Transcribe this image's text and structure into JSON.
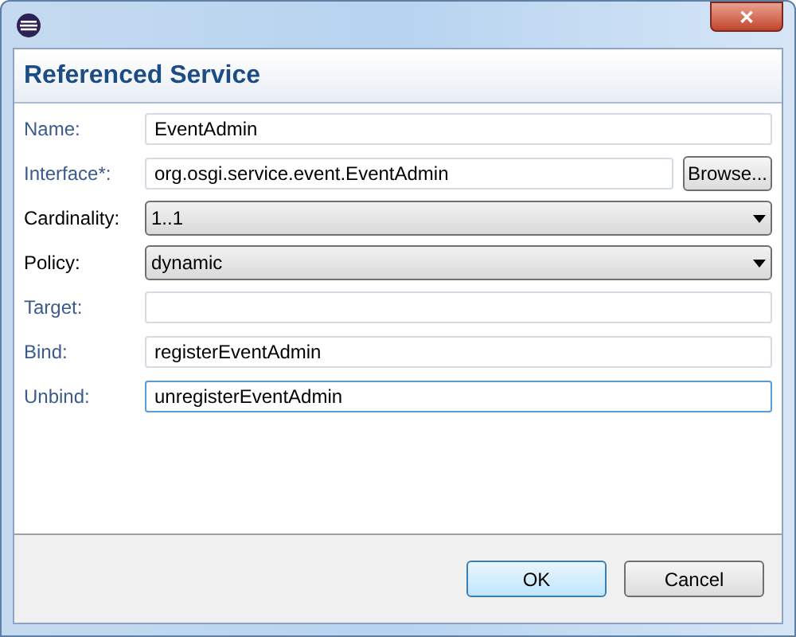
{
  "window": {
    "close_glyph": "✕"
  },
  "header": {
    "title": "Referenced Service"
  },
  "fields": [
    {
      "kind": "text",
      "label": "Name:",
      "link": true,
      "value": "EventAdmin",
      "focused": false
    },
    {
      "kind": "text",
      "label": "Interface*:",
      "link": true,
      "value": "org.osgi.service.event.EventAdmin",
      "focused": false,
      "button": "Browse..."
    },
    {
      "kind": "combo",
      "label": "Cardinality:",
      "link": false,
      "value": "1..1"
    },
    {
      "kind": "combo",
      "label": "Policy:",
      "link": false,
      "value": "dynamic"
    },
    {
      "kind": "text",
      "label": "Target:",
      "link": true,
      "focused": false
    },
    {
      "kind": "text",
      "label": "Bind:",
      "link": true,
      "value": "registerEventAdmin",
      "focused": false
    },
    {
      "kind": "text",
      "label": "Unbind:",
      "link": true,
      "value": "unregisterEventAdmin",
      "focused": true
    }
  ],
  "buttons": [
    {
      "label": "OK",
      "default": true
    },
    {
      "label": "Cancel",
      "default": false
    }
  ]
}
